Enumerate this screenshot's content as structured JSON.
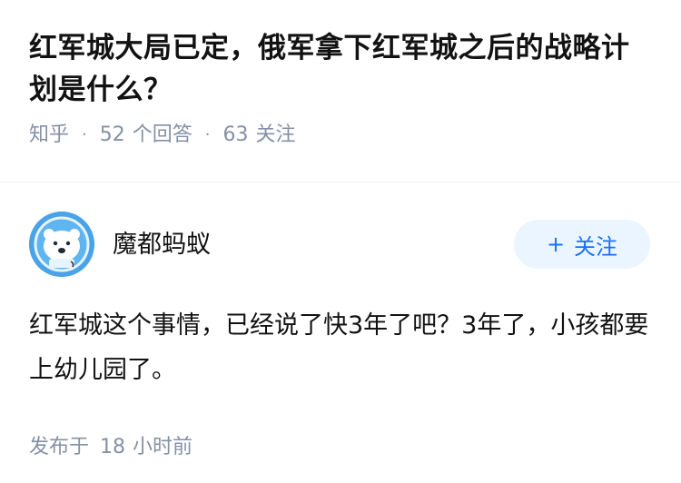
{
  "question": {
    "title": "红军城大局已定，俄军拿下红军城之后的战略计划是什么？",
    "source": "知乎",
    "answer_count": "52",
    "answer_label": "个回答",
    "follow_count": "63",
    "follow_label": "关注",
    "separator": "·"
  },
  "answer": {
    "author_name": "魔都蚂蚁",
    "avatar_icon": "polar-bear-avatar-icon",
    "follow_button_plus": "+",
    "follow_button_label": "关注",
    "content": "红军城这个事情，已经说了快3年了吧？3年了，小孩都要上幼儿园了。",
    "published_label": "发布于",
    "published_number": "18",
    "published_unit": "小时前"
  },
  "colors": {
    "title": "#121212",
    "meta": "#8590a6",
    "accent": "#1772f6",
    "button_bg": "#ebf5ff",
    "avatar_bg": "#4aa3e8"
  }
}
